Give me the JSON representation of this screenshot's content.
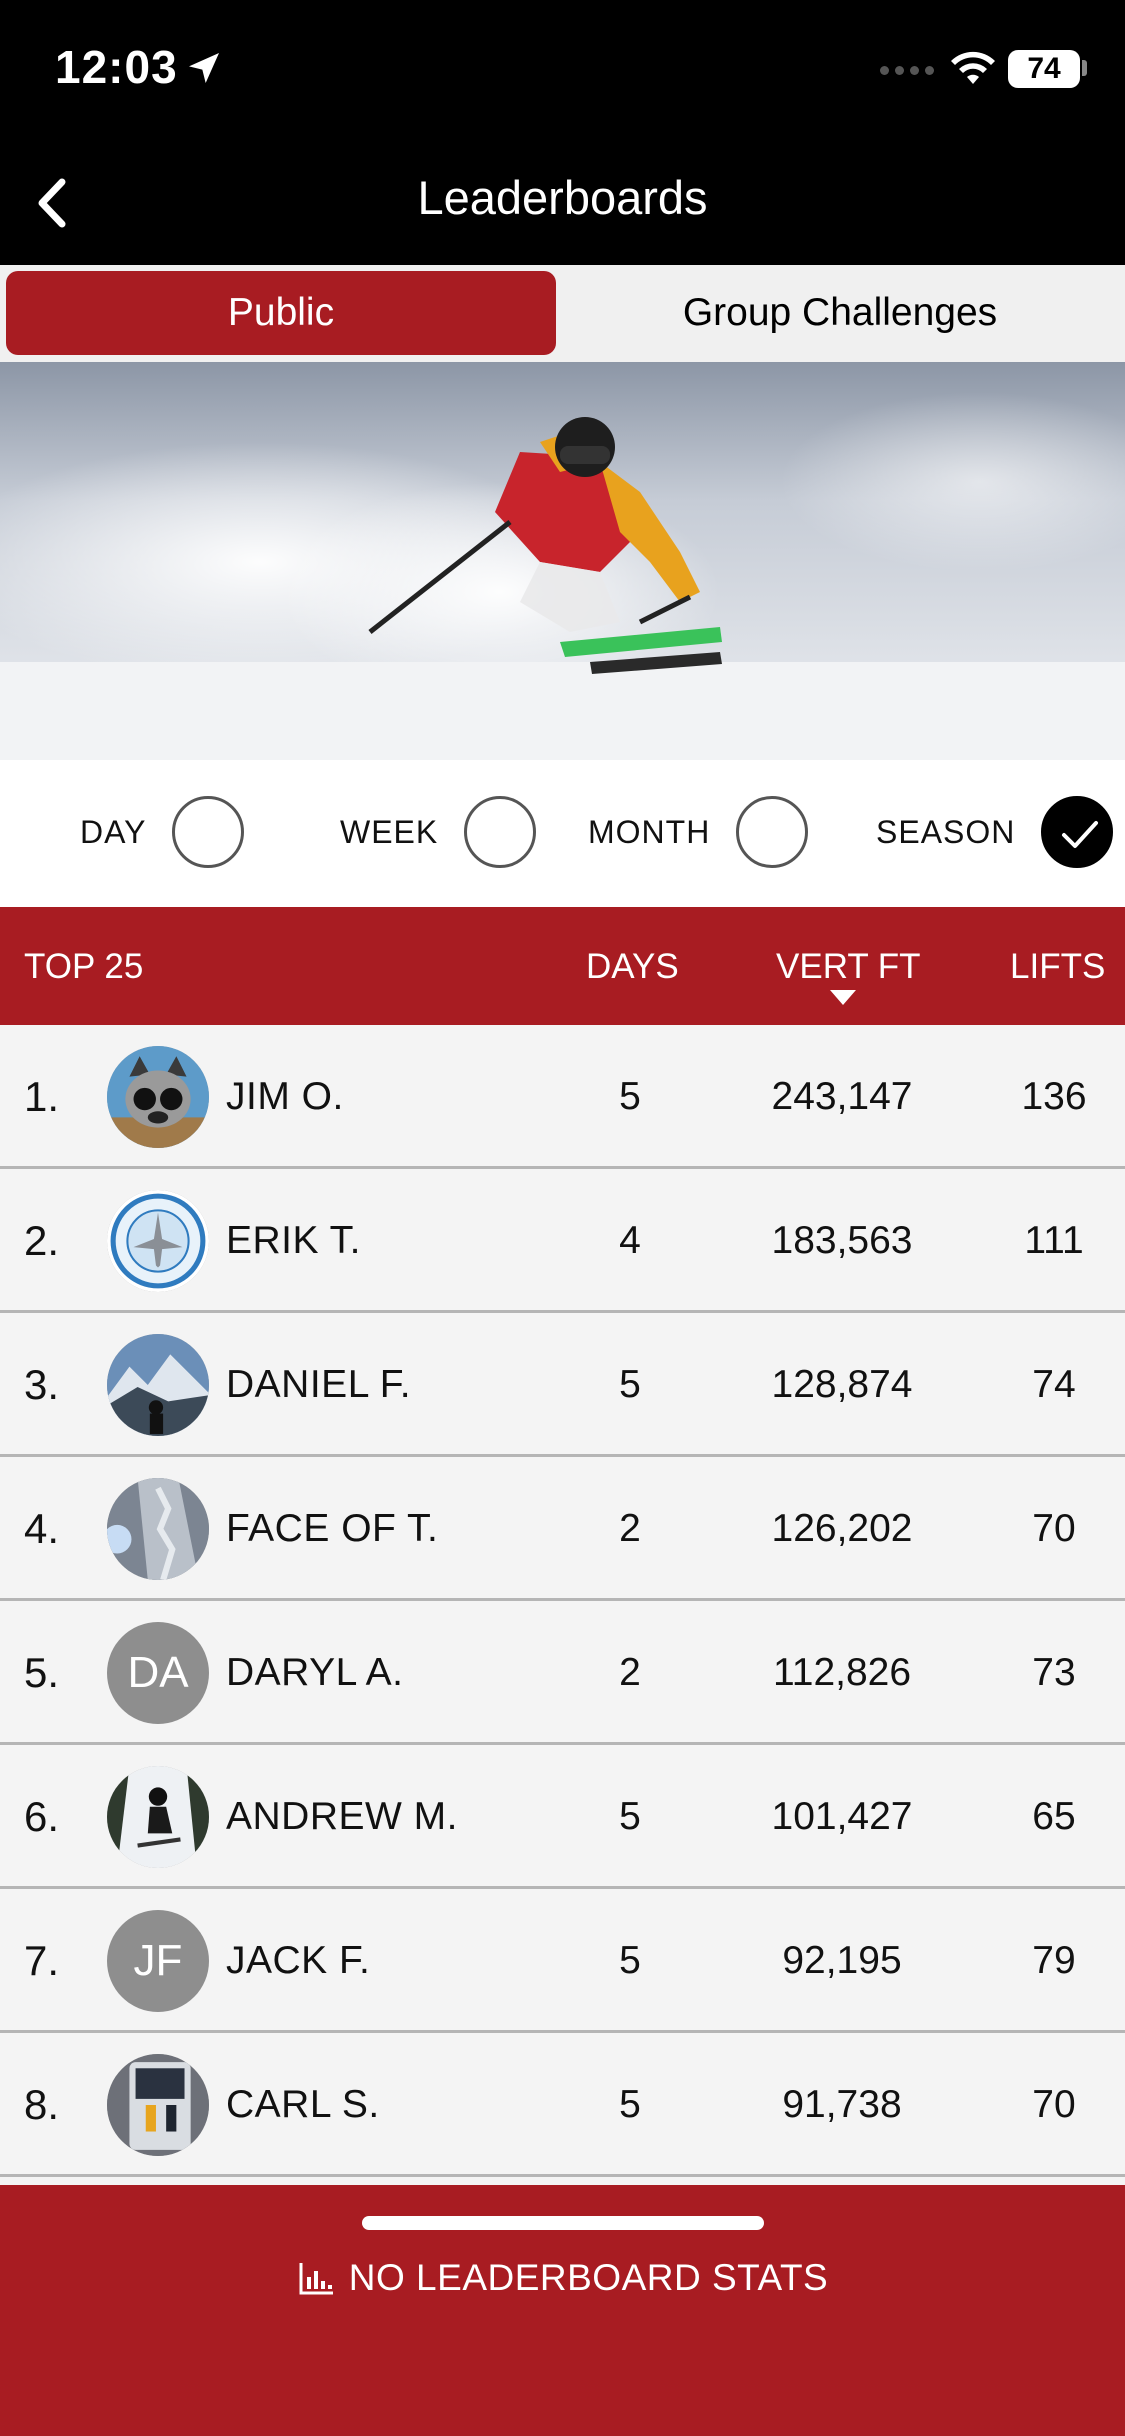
{
  "status_bar": {
    "time": "12:03",
    "battery": "74"
  },
  "nav": {
    "title": "Leaderboards"
  },
  "segments": {
    "public": "Public",
    "group": "Group Challenges"
  },
  "filters": {
    "day": "DAY",
    "week": "WEEK",
    "month": "MONTH",
    "season": "SEASON",
    "selected": "SEASON"
  },
  "table": {
    "headers": {
      "top": "TOP 25",
      "days": "DAYS",
      "vert": "VERT FT",
      "lifts": "LIFTS"
    },
    "rows": [
      {
        "rank": "1.",
        "name": "JIM O.",
        "days": "5",
        "vert": "243,147",
        "lifts": "136",
        "avatar": "raccoon-avatar"
      },
      {
        "rank": "2.",
        "name": "ERIK T.",
        "days": "4",
        "vert": "183,563",
        "lifts": "111",
        "avatar": "squadron-patch-avatar"
      },
      {
        "rank": "3.",
        "name": "DANIEL F.",
        "days": "5",
        "vert": "128,874",
        "lifts": "74",
        "avatar": "mountain-photo-avatar"
      },
      {
        "rank": "4.",
        "name": "FACE OF T.",
        "days": "2",
        "vert": "126,202",
        "lifts": "70",
        "avatar": "snow-face-avatar"
      },
      {
        "rank": "5.",
        "name": "DARYL A.",
        "days": "2",
        "vert": "112,826",
        "lifts": "73",
        "avatar": "DA"
      },
      {
        "rank": "6.",
        "name": "ANDREW M.",
        "days": "5",
        "vert": "101,427",
        "lifts": "65",
        "avatar": "skier-photo-avatar"
      },
      {
        "rank": "7.",
        "name": "JACK F.",
        "days": "5",
        "vert": "92,195",
        "lifts": "79",
        "avatar": "JF"
      },
      {
        "rank": "8.",
        "name": "CARL S.",
        "days": "5",
        "vert": "91,738",
        "lifts": "70",
        "avatar": "bus-photo-avatar"
      }
    ]
  },
  "footer": {
    "label": "NO LEADERBOARD STATS"
  },
  "colors": {
    "brand_red": "#a81c22",
    "nav_bg": "#000000",
    "row_bg": "#f4f4f4"
  }
}
